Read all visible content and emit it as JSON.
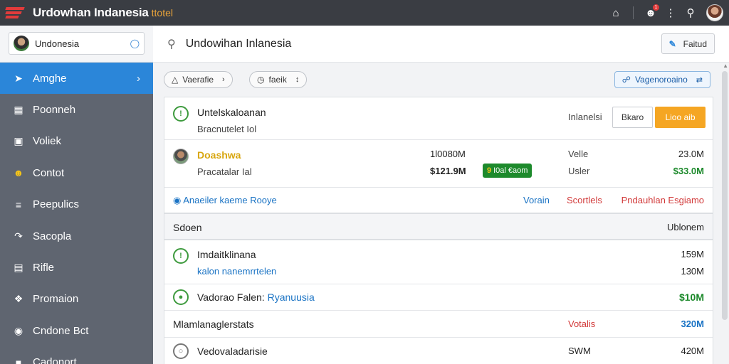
{
  "app": {
    "title": "Urdowhan Indanesia",
    "subtitle": "ttotel"
  },
  "topbar": {
    "icons": [
      "home-icon",
      "user-alert-icon",
      "more-icon",
      "search-icon",
      "avatar"
    ],
    "badge": "1"
  },
  "sidebar": {
    "search_value": "Undonesia",
    "items": [
      {
        "label": "Amghe",
        "icon": "rocket-icon",
        "active": true
      },
      {
        "label": "Poonneh",
        "icon": "chart-icon"
      },
      {
        "label": "Voliek",
        "icon": "briefcase-icon"
      },
      {
        "label": "Contot",
        "icon": "smile-icon"
      },
      {
        "label": "Peepulics",
        "icon": "layers-icon"
      },
      {
        "label": "Sacopla",
        "icon": "export-icon"
      },
      {
        "label": "Rifle",
        "icon": "calendar-icon"
      },
      {
        "label": "Promaion",
        "icon": "tag-icon"
      },
      {
        "label": "Cndone Bct",
        "icon": "camera-icon"
      },
      {
        "label": "Cadonort",
        "icon": "folder-icon"
      }
    ]
  },
  "header": {
    "title": "Undowihan Inlanesia",
    "button_label": "Faitud"
  },
  "filters": {
    "pill1": "Vaerafie",
    "pill2": "faeik",
    "right": "Vagenoroaino"
  },
  "card1": {
    "row1": {
      "title": "Untelskaloanan",
      "sub": "Bracnutelet Iol",
      "label": "Inlanelsi",
      "btn_outline": "Bkaro",
      "btn_orange": "Lioo aib"
    },
    "row2": {
      "title": "Doashwa",
      "sub": "Pracatalar Ial",
      "amt1": "1l0080M",
      "amt2": "$121.9M",
      "pill_pre": "9",
      "pill": "I0al €aom",
      "label1": "Velle",
      "label2": "Usler",
      "val1": "23.0M",
      "val2": "$33.0M"
    },
    "footer": {
      "link": "Anaeiler kaeme Rooye",
      "a": "Vorain",
      "b": "Scortlels",
      "c": "Pndauhlan Esgiamo"
    }
  },
  "section": {
    "left": "Sdoen",
    "right": "Ublonem"
  },
  "card2": {
    "row1": {
      "title": "Imdaitklinana",
      "sub": "kalon nanemrrtelen",
      "v1": "159M",
      "v2": "130M"
    },
    "row2": {
      "title": "Vadorao Falen:",
      "title_link": "Ryanuusia",
      "value": "$10M"
    },
    "row3": {
      "title": "Mlamlanaglerstats",
      "mid": "Votalis",
      "value": "320M"
    },
    "row4": {
      "title": "Vedovaladarisie",
      "mid": "SWM",
      "value": "420M"
    }
  }
}
